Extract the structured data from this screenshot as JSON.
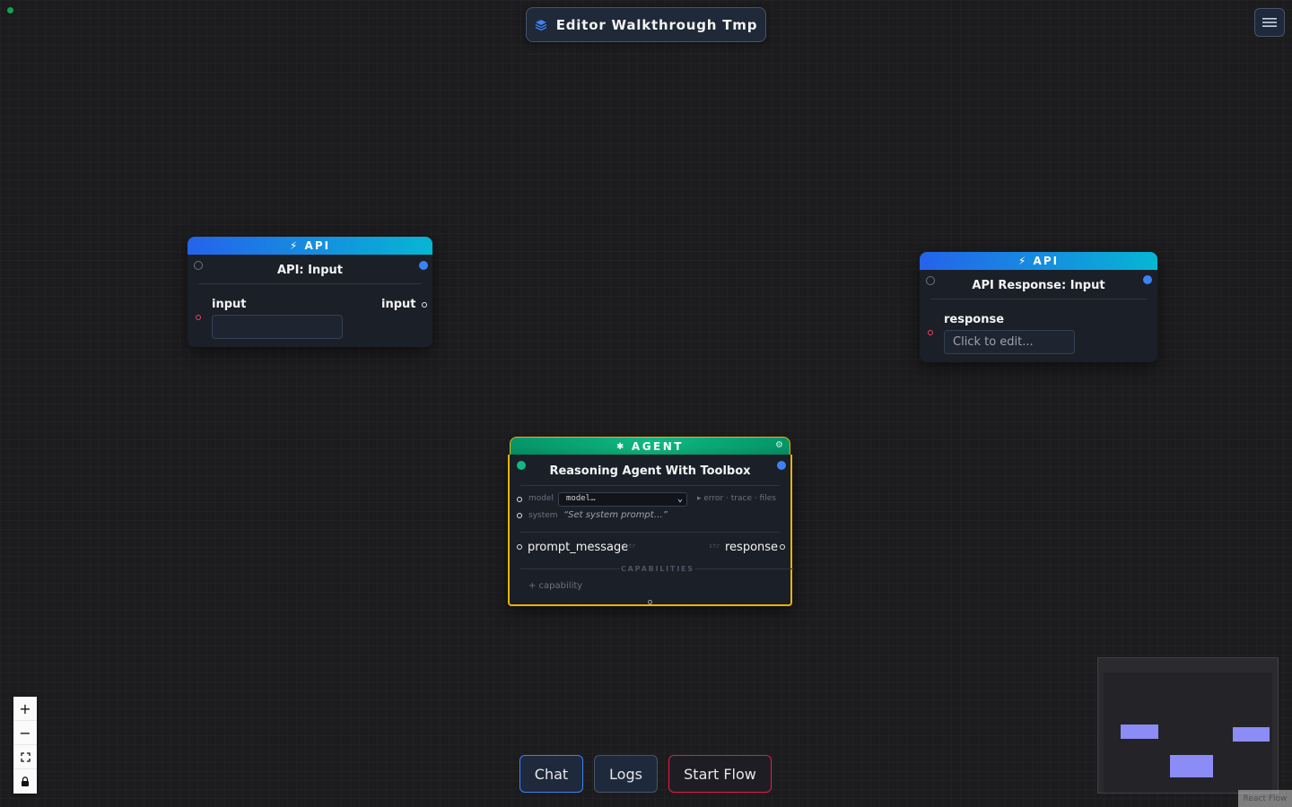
{
  "flow_title": "Editor Walkthrough Tmp",
  "nodes": {
    "api_input": {
      "badge": "⚡ API",
      "title": "API: Input",
      "field_label": "input",
      "output_label": "input",
      "field_value": ""
    },
    "api_response": {
      "badge": "⚡ API",
      "title": "API Response: Input",
      "field_label": "response",
      "field_placeholder": "Click to edit..."
    },
    "agent": {
      "badge": "AGENT",
      "title": "Reasoning Agent With Toolbox",
      "model_label": "model",
      "model_value": "model…",
      "meta_links": "▸ error · trace · files",
      "system_label": "system",
      "system_placeholder": "“Set system prompt…”",
      "input_port": "prompt_message",
      "input_type": "str",
      "output_port": "response",
      "output_type": "str",
      "capabilities_title": "CAPABILITIES",
      "add_capability": "+ capability"
    }
  },
  "bottom_bar": {
    "chat": "Chat",
    "logs": "Logs",
    "start_flow": "Start Flow"
  },
  "zoom_controls": {
    "zoom_in": "+",
    "zoom_out": "−"
  },
  "attribution": "React Flow",
  "colors": {
    "api_header_start": "#2563eb",
    "api_header_end": "#06b6d4",
    "agent_header": "#10b981",
    "selected_outline": "#eab308",
    "start_flow_border": "#e11d48",
    "chat_border": "#3b82f6",
    "minimap_node": "#8b8cf6"
  }
}
